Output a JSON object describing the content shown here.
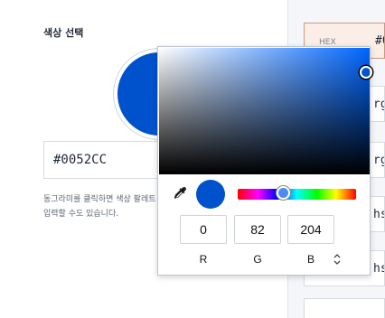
{
  "left": {
    "section_title": "색상 선택",
    "hex_value": "#0052CC",
    "help_line1": "동그라미를 클릭하면 색상 팔레트",
    "help_line2": "입력할 수도 있습니다."
  },
  "formats": [
    {
      "label": "HEX",
      "value": "#0"
    },
    {
      "label": "",
      "value": "rg"
    },
    {
      "label": "",
      "value": "rg"
    },
    {
      "label": "",
      "value": "hs"
    },
    {
      "label": "",
      "value": "hs"
    }
  ],
  "picker": {
    "r_value": "0",
    "g_value": "82",
    "b_value": "204",
    "r_label": "R",
    "g_label": "G",
    "b_label": "B",
    "toggle_glyph": "⌃⌄",
    "hue_level": 0.6
  },
  "colors": {
    "selected": "#0052CC",
    "hue_pure": "#0066FF"
  },
  "icons": {
    "eyedropper": "eyedropper-icon",
    "toggle": "chevron-up-down-icon"
  }
}
